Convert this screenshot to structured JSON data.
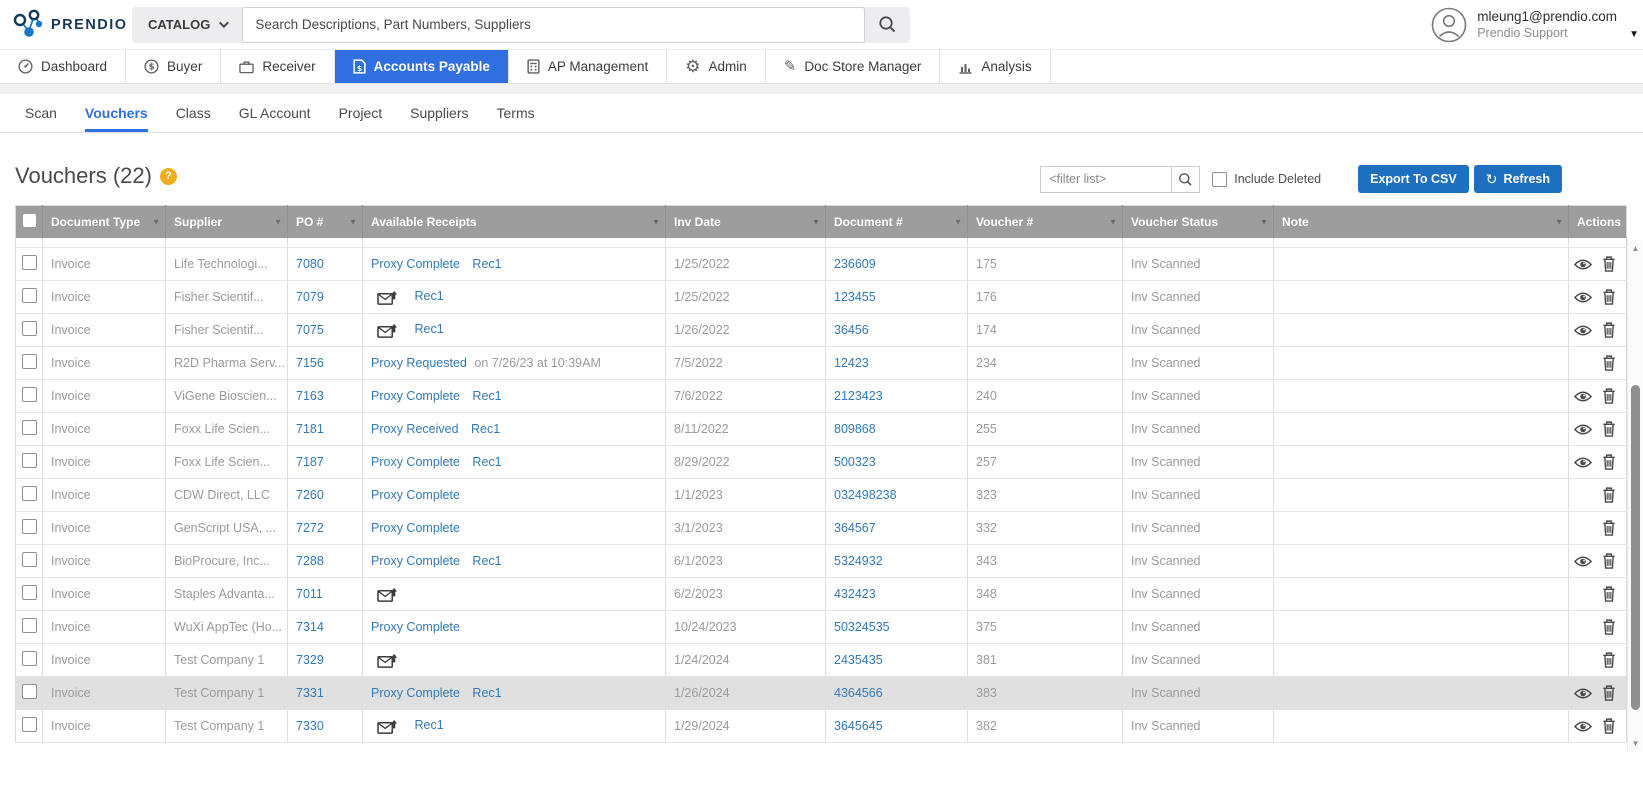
{
  "header": {
    "brand": "PRENDIO",
    "catalog_button": "CATALOG",
    "search_placeholder": "Search Descriptions, Part Numbers, Suppliers",
    "user": {
      "email": "mleung1@prendio.com",
      "org": "Prendio Support"
    }
  },
  "nav": {
    "items": [
      {
        "label": "Dashboard",
        "icon": "gauge-icon",
        "active": false
      },
      {
        "label": "Buyer",
        "icon": "dollar-circle-icon",
        "active": false
      },
      {
        "label": "Receiver",
        "icon": "briefcase-icon",
        "active": false
      },
      {
        "label": "Accounts Payable",
        "icon": "invoice-doc-icon",
        "active": true
      },
      {
        "label": "AP Management",
        "icon": "calculator-icon",
        "active": false
      },
      {
        "label": "Admin",
        "icon": "gear-icon",
        "active": false
      },
      {
        "label": "Doc Store Manager",
        "icon": "pencil-icon",
        "active": false
      },
      {
        "label": "Analysis",
        "icon": "bar-chart-icon",
        "active": false
      }
    ]
  },
  "subnav": {
    "items": [
      {
        "label": "Scan",
        "active": false
      },
      {
        "label": "Vouchers",
        "active": true
      },
      {
        "label": "Class",
        "active": false
      },
      {
        "label": "GL Account",
        "active": false
      },
      {
        "label": "Project",
        "active": false
      },
      {
        "label": "Suppliers",
        "active": false
      },
      {
        "label": "Terms",
        "active": false
      }
    ]
  },
  "toolbar": {
    "title": "Vouchers (22)",
    "help_badge": "?",
    "filter_placeholder": "<filter list>",
    "include_deleted_label": "Include Deleted",
    "export_csv_label": "Export To CSV",
    "refresh_label": "Refresh"
  },
  "table": {
    "columns": [
      "Document Type",
      "Supplier",
      "PO #",
      "Available Receipts",
      "Inv Date",
      "Document #",
      "Voucher #",
      "Voucher Status",
      "Note",
      "Actions"
    ],
    "rows": [
      {
        "doc_type": "Invoice",
        "supplier": "Life Technologi...",
        "po": "7080",
        "receipt_icon": false,
        "receipt_status": "Proxy Complete",
        "receipt_detail": null,
        "receipt_rec": "Rec1",
        "inv_date": "1/25/2022",
        "doc_num": "236609",
        "voucher_num": "175",
        "status": "Inv Scanned",
        "note": "",
        "actions": [
          "view",
          "delete"
        ],
        "highlighted": false
      },
      {
        "doc_type": "Invoice",
        "supplier": "Fisher Scientif...",
        "po": "7079",
        "receipt_icon": true,
        "receipt_status": null,
        "receipt_detail": null,
        "receipt_rec": "Rec1",
        "inv_date": "1/25/2022",
        "doc_num": "123455",
        "voucher_num": "176",
        "status": "Inv Scanned",
        "note": "",
        "actions": [
          "view",
          "delete"
        ],
        "highlighted": false
      },
      {
        "doc_type": "Invoice",
        "supplier": "Fisher Scientif...",
        "po": "7075",
        "receipt_icon": true,
        "receipt_status": null,
        "receipt_detail": null,
        "receipt_rec": "Rec1",
        "inv_date": "1/26/2022",
        "doc_num": "36456",
        "voucher_num": "174",
        "status": "Inv Scanned",
        "note": "",
        "actions": [
          "view",
          "delete"
        ],
        "highlighted": false
      },
      {
        "doc_type": "Invoice",
        "supplier": "R2D Pharma Serv...",
        "po": "7156",
        "receipt_icon": false,
        "receipt_status": "Proxy Requested",
        "receipt_detail": "on 7/26/23 at 10:39AM",
        "receipt_rec": null,
        "inv_date": "7/5/2022",
        "doc_num": "12423",
        "voucher_num": "234",
        "status": "Inv Scanned",
        "note": "",
        "actions": [
          "delete"
        ],
        "highlighted": false
      },
      {
        "doc_type": "Invoice",
        "supplier": "ViGene Bioscien...",
        "po": "7163",
        "receipt_icon": false,
        "receipt_status": "Proxy Complete",
        "receipt_detail": null,
        "receipt_rec": "Rec1",
        "inv_date": "7/6/2022",
        "doc_num": "2123423",
        "voucher_num": "240",
        "status": "Inv Scanned",
        "note": "",
        "actions": [
          "view",
          "delete"
        ],
        "highlighted": false
      },
      {
        "doc_type": "Invoice",
        "supplier": "Foxx Life Scien...",
        "po": "7181",
        "receipt_icon": false,
        "receipt_status": "Proxy Received",
        "receipt_detail": null,
        "receipt_rec": "Rec1",
        "inv_date": "8/11/2022",
        "doc_num": "809868",
        "voucher_num": "255",
        "status": "Inv Scanned",
        "note": "",
        "actions": [
          "view",
          "delete"
        ],
        "highlighted": false
      },
      {
        "doc_type": "Invoice",
        "supplier": "Foxx Life Scien...",
        "po": "7187",
        "receipt_icon": false,
        "receipt_status": "Proxy Complete",
        "receipt_detail": null,
        "receipt_rec": "Rec1",
        "inv_date": "8/29/2022",
        "doc_num": "500323",
        "voucher_num": "257",
        "status": "Inv Scanned",
        "note": "",
        "actions": [
          "view",
          "delete"
        ],
        "highlighted": false
      },
      {
        "doc_type": "Invoice",
        "supplier": "CDW Direct, LLC",
        "po": "7260",
        "receipt_icon": false,
        "receipt_status": "Proxy Complete",
        "receipt_detail": null,
        "receipt_rec": null,
        "inv_date": "1/1/2023",
        "doc_num": "032498238",
        "voucher_num": "323",
        "status": "Inv Scanned",
        "note": "",
        "actions": [
          "delete"
        ],
        "highlighted": false
      },
      {
        "doc_type": "Invoice",
        "supplier": "GenScript USA, ...",
        "po": "7272",
        "receipt_icon": false,
        "receipt_status": "Proxy Complete",
        "receipt_detail": null,
        "receipt_rec": null,
        "inv_date": "3/1/2023",
        "doc_num": "364567",
        "voucher_num": "332",
        "status": "Inv Scanned",
        "note": "",
        "actions": [
          "delete"
        ],
        "highlighted": false
      },
      {
        "doc_type": "Invoice",
        "supplier": "BioProcure, Inc...",
        "po": "7288",
        "receipt_icon": false,
        "receipt_status": "Proxy Complete",
        "receipt_detail": null,
        "receipt_rec": "Rec1",
        "inv_date": "6/1/2023",
        "doc_num": "5324932",
        "voucher_num": "343",
        "status": "Inv Scanned",
        "note": "",
        "actions": [
          "view",
          "delete"
        ],
        "highlighted": false
      },
      {
        "doc_type": "Invoice",
        "supplier": "Staples Advanta...",
        "po": "7011",
        "receipt_icon": true,
        "receipt_status": null,
        "receipt_detail": null,
        "receipt_rec": null,
        "inv_date": "6/2/2023",
        "doc_num": "432423",
        "voucher_num": "348",
        "status": "Inv Scanned",
        "note": "",
        "actions": [
          "delete"
        ],
        "highlighted": false
      },
      {
        "doc_type": "Invoice",
        "supplier": "WuXi AppTec (Ho...",
        "po": "7314",
        "receipt_icon": false,
        "receipt_status": "Proxy Complete",
        "receipt_detail": null,
        "receipt_rec": null,
        "inv_date": "10/24/2023",
        "doc_num": "50324535",
        "voucher_num": "375",
        "status": "Inv Scanned",
        "note": "",
        "actions": [
          "delete"
        ],
        "highlighted": false
      },
      {
        "doc_type": "Invoice",
        "supplier": "Test Company 1",
        "po": "7329",
        "receipt_icon": true,
        "receipt_status": null,
        "receipt_detail": null,
        "receipt_rec": null,
        "inv_date": "1/24/2024",
        "doc_num": "2435435",
        "voucher_num": "381",
        "status": "Inv Scanned",
        "note": "",
        "actions": [
          "delete"
        ],
        "highlighted": false
      },
      {
        "doc_type": "Invoice",
        "supplier": "Test Company 1",
        "po": "7331",
        "receipt_icon": false,
        "receipt_status": "Proxy Complete",
        "receipt_detail": null,
        "receipt_rec": "Rec1",
        "inv_date": "1/26/2024",
        "doc_num": "4364566",
        "voucher_num": "383",
        "status": "Inv Scanned",
        "note": "",
        "actions": [
          "view",
          "delete"
        ],
        "highlighted": true
      },
      {
        "doc_type": "Invoice",
        "supplier": "Test Company 1",
        "po": "7330",
        "receipt_icon": true,
        "receipt_status": null,
        "receipt_detail": null,
        "receipt_rec": "Rec1",
        "inv_date": "1/29/2024",
        "doc_num": "3645645",
        "voucher_num": "382",
        "status": "Inv Scanned",
        "note": "",
        "actions": [
          "view",
          "delete"
        ],
        "highlighted": false
      }
    ]
  },
  "icons": {
    "sort-caret": "▼",
    "user-caret": "▼",
    "scroll-up": "▲",
    "scroll-down": "▼",
    "refresh-glyph": "↻",
    "gear-glyph": "⚙",
    "pencil-glyph": "✎"
  },
  "colors": {
    "active_tab_blue": "#2f6fe0",
    "button_blue": "#1d6fc0",
    "link_blue": "#337ab7",
    "table_header_gray": "#9d9d9d",
    "highlight_row_gray": "#e0e0e0",
    "help_badge_yellow": "#f0ad1e",
    "brand_navy": "#16395c",
    "brand_blue": "#1779c4"
  }
}
